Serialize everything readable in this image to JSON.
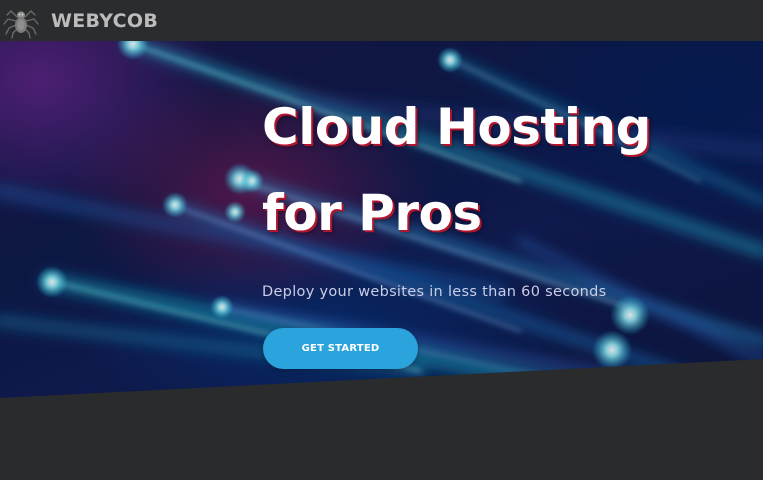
{
  "brand": {
    "name": "WEBYCOB",
    "logo_icon": "spider-icon"
  },
  "hero": {
    "title_line1": "Cloud Hosting",
    "title_line2": "for Pros",
    "subtitle": "Deploy your websites in less than 60 seconds",
    "cta_label": "GET STARTED"
  },
  "colors": {
    "header_bg": "#2b2c2d",
    "page_bg": "#2a2b2c",
    "cta": "#2ba3dc",
    "title_shadow": "#b0152e"
  }
}
